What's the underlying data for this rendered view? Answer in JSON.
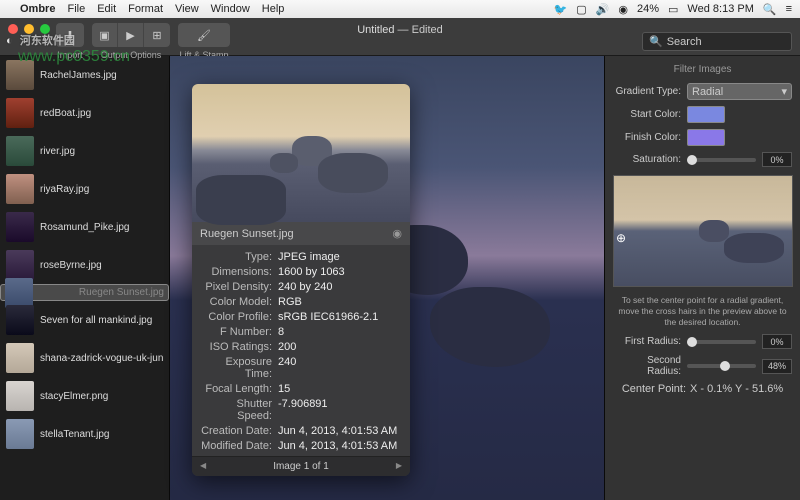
{
  "menubar": {
    "app": "Ombre",
    "items": [
      "File",
      "Edit",
      "Format",
      "View",
      "Window",
      "Help"
    ],
    "battery": "24%",
    "clock": "Wed 8:13 PM"
  },
  "watermark": {
    "text": "河东软件园",
    "url": "www.pc0359.cn"
  },
  "toolbar": {
    "import": "Import",
    "output": "Output Options",
    "lift": "Lift & Stamp",
    "title_a": "Untitled",
    "title_b": " — Edited",
    "search_ph": "Search"
  },
  "sidebar": {
    "items": [
      {
        "label": "RachelJames.jpg"
      },
      {
        "label": "redBoat.jpg"
      },
      {
        "label": "river.jpg"
      },
      {
        "label": "riyaRay.jpg"
      },
      {
        "label": "Rosamund_Pike.jpg"
      },
      {
        "label": "roseByrne.jpg"
      },
      {
        "label": "Ruegen Sunset.jpg",
        "selected": true
      },
      {
        "label": "Seven for all mankind.jpg"
      },
      {
        "label": "shana-zadrick-vogue-uk-jun"
      },
      {
        "label": "stacyElmer.png"
      },
      {
        "label": "stellaTenant.jpg"
      }
    ]
  },
  "popup": {
    "image_name": "Ruegen Sunset.jpg",
    "meta": [
      {
        "k": "Type:",
        "v": "JPEG image"
      },
      {
        "k": "Dimensions:",
        "v": "1600 by 1063"
      },
      {
        "k": "Pixel Density:",
        "v": "240 by 240"
      },
      {
        "k": "Color Model:",
        "v": "RGB"
      },
      {
        "k": "Color Profile:",
        "v": "sRGB IEC61966-2.1"
      },
      {
        "k": "F Number:",
        "v": "8"
      },
      {
        "k": "ISO Ratings:",
        "v": "200"
      },
      {
        "k": "Exposure Time:",
        "v": "240"
      },
      {
        "k": "Focal Length:",
        "v": "15"
      },
      {
        "k": "Shutter Speed:",
        "v": "-7.906891"
      },
      {
        "k": "Creation Date:",
        "v": "Jun 4, 2013, 4:01:53 AM"
      },
      {
        "k": "Modified Date:",
        "v": "Jun 4, 2013, 4:01:53 AM"
      }
    ],
    "footer": "Image 1 of 1"
  },
  "inspector": {
    "header": "Filter Images",
    "gradient_label": "Gradient Type:",
    "gradient_value": "Radial",
    "start_label": "Start Color:",
    "start_color": "#7a88e0",
    "finish_label": "Finish Color:",
    "finish_color": "#8a78e8",
    "sat_label": "Saturation:",
    "sat_pct": "0%",
    "hint": "To set the center point  for a radial gradient, move the cross hairs in the preview above to the desired location.",
    "r1_label": "First Radius:",
    "r1_pct": "0%",
    "r2_label": "Second Radius:",
    "r2_pct": "48%",
    "center_label": "Center Point:",
    "center_value": "X - 0.1%   Y - 51.6%"
  }
}
